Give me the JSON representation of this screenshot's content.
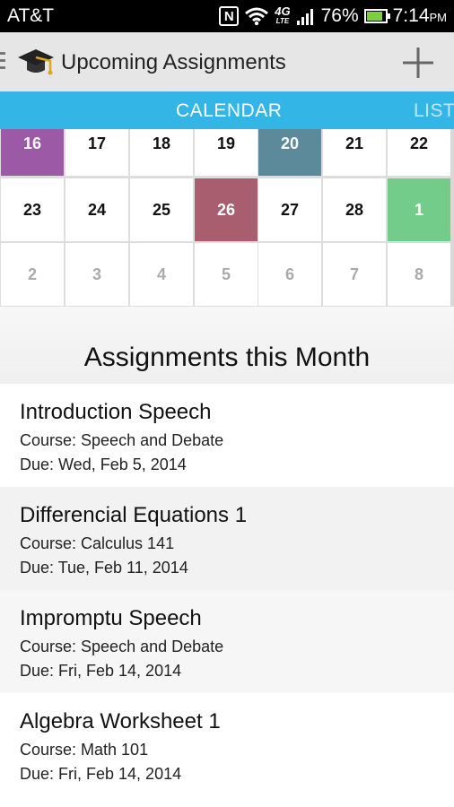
{
  "status_bar": {
    "carrier": "AT&T",
    "nfc": "N",
    "network": "4G",
    "network_sub": "LTE",
    "battery": "76%",
    "battery_level": 0.76,
    "time": "7:14",
    "ampm": "PM"
  },
  "action_bar": {
    "title": "Upcoming Assignments",
    "icons": [
      "drawer-icon",
      "graduation-cap-icon",
      "plus-icon"
    ]
  },
  "tabs": {
    "calendar": "CALENDAR",
    "list": "LIST"
  },
  "calendar": {
    "row1": [
      {
        "d": "16",
        "color": "#9b59a6"
      },
      {
        "d": "17"
      },
      {
        "d": "18"
      },
      {
        "d": "19"
      },
      {
        "d": "20",
        "color": "#5d8a9a"
      },
      {
        "d": "21"
      },
      {
        "d": "22"
      }
    ],
    "row2": [
      {
        "d": "23"
      },
      {
        "d": "24"
      },
      {
        "d": "25"
      },
      {
        "d": "26",
        "color": "#a85e6e"
      },
      {
        "d": "27"
      },
      {
        "d": "28"
      },
      {
        "d": "1",
        "color": "#74cc8a"
      }
    ],
    "row3": [
      {
        "d": "2",
        "dim": true
      },
      {
        "d": "3",
        "dim": true
      },
      {
        "d": "4",
        "dim": true
      },
      {
        "d": "5",
        "dim": true
      },
      {
        "d": "6",
        "dim": true
      },
      {
        "d": "7",
        "dim": true
      },
      {
        "d": "8",
        "dim": true
      }
    ]
  },
  "section": {
    "title": "Assignments this Month"
  },
  "assignments": [
    {
      "name": "Introduction Speech",
      "course": "Course: Speech and Debate",
      "due": "Due: Wed, Feb 5, 2014"
    },
    {
      "name": "Differencial Equations 1",
      "course": "Course: Calculus 141",
      "due": "Due: Tue, Feb 11, 2014"
    },
    {
      "name": "Impromptu Speech",
      "course": "Course: Speech and Debate",
      "due": "Due: Fri, Feb 14, 2014"
    },
    {
      "name": "Algebra Worksheet 1",
      "course": "Course: Math 101",
      "due": "Due: Fri, Feb 14, 2014"
    }
  ],
  "colors": {
    "tab_accent": "#33b5e5",
    "action_bar": "#e6e6e6"
  }
}
